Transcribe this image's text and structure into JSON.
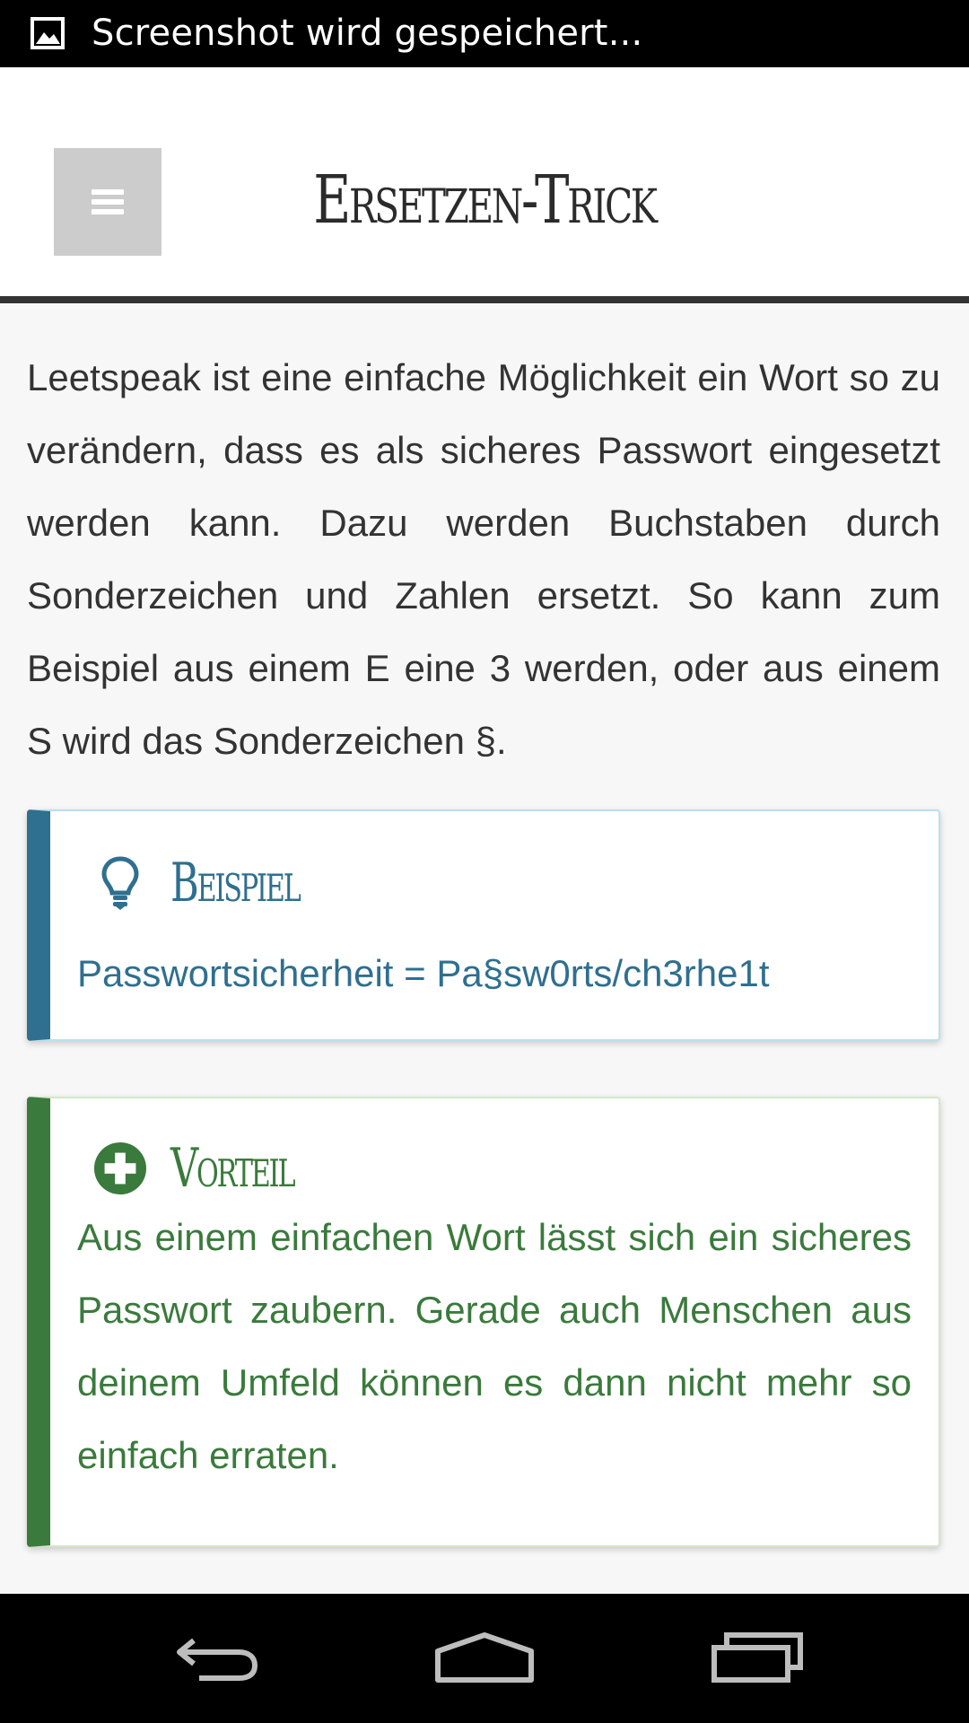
{
  "status_bar": {
    "notification_icon": "image-icon",
    "text": "Screenshot wird gespeichert..."
  },
  "header": {
    "menu_icon": "hamburger-menu-icon",
    "title": "Ersetzen-Trick"
  },
  "content": {
    "intro": "Leetspeak ist eine einfache Möglichkeit ein Wort so zu verändern, dass es als sicheres Passwort eingesetzt werden kann. Dazu werden Buchstaben durch Sonderzeichen und Zahlen ersetzt. So kann zum Beispiel aus einem E eine 3 werden, oder aus einem S wird das Sonderzeichen §."
  },
  "example_box": {
    "icon": "lightbulb-icon",
    "heading": "Beispiel",
    "text": "Passwortsicherheit = Pa§sw0rts/ch3rhe1t",
    "accent_color": "#2f6f8f"
  },
  "advantage_box": {
    "icon": "plus-circle-icon",
    "heading": "Vorteil",
    "text": "Aus einem einfachen Wort lässt sich ein sicheres Passwort zaubern. Gerade auch Menschen aus deinem Umfeld können es dann nicht mehr so einfach erraten.",
    "accent_color": "#3a7a3c"
  },
  "nav_bar": {
    "back_icon": "back-icon",
    "home_icon": "home-icon",
    "recent_icon": "recent-apps-icon"
  }
}
